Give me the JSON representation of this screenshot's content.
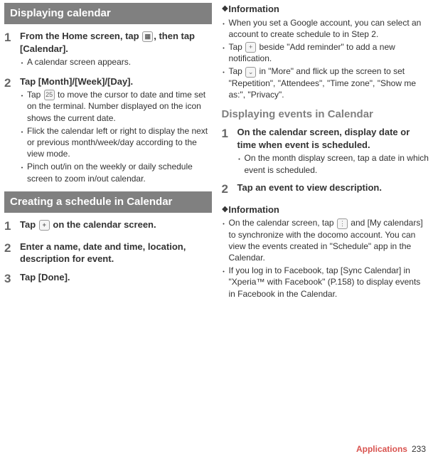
{
  "left": {
    "section1": {
      "title": "Displaying calendar",
      "steps": [
        {
          "num": "1",
          "title_a": "From the Home screen, tap ",
          "title_b": ", then tap [Calendar].",
          "icon": "grid-icon",
          "bullets": [
            "A calendar screen appears."
          ]
        },
        {
          "num": "2",
          "title": "Tap [Month]/[Week]/[Day].",
          "bullets_rich": [
            {
              "pre": "Tap ",
              "icon": "25",
              "post": " to move the cursor to date and time set on the terminal. Number displayed on the icon shows the current date."
            },
            {
              "text": "Flick the calendar left or right to display the next or previous month/week/day according to the view mode."
            },
            {
              "text": "Pinch out/in on the weekly or daily schedule screen to zoom in/out calendar."
            }
          ]
        }
      ]
    },
    "section2": {
      "title": "Creating a schedule in Calendar",
      "steps": [
        {
          "num": "1",
          "title_a": "Tap ",
          "icon": "+",
          "title_b": " on the calendar screen."
        },
        {
          "num": "2",
          "title": "Enter a name, date and time, location, description for event."
        },
        {
          "num": "3",
          "title": "Tap [Done]."
        }
      ]
    }
  },
  "right": {
    "info1": {
      "head": "Information",
      "bullets_rich": [
        {
          "text": "When you set a Google account, you can select an account to create schedule to in Step 2."
        },
        {
          "pre": "Tap ",
          "icon": "+",
          "post": " beside \"Add reminder\" to add a new notification."
        },
        {
          "pre": "Tap ",
          "icon": "⌄",
          "post": " in \"More\" and flick up the screen to set \"Repetition\", \"Attendees\", \"Time zone\", \"Show me as:\", \"Privacy\"."
        }
      ]
    },
    "subhead": "Displaying events in Calendar",
    "steps": [
      {
        "num": "1",
        "title": "On the calendar screen, display date or time when event is scheduled.",
        "bullets": [
          "On the month display screen, tap a date in which event is scheduled."
        ]
      },
      {
        "num": "2",
        "title": "Tap an event to view description."
      }
    ],
    "info2": {
      "head": "Information",
      "bullets_rich": [
        {
          "pre": "On the calendar screen, tap ",
          "icon": "⋮",
          "post": " and [My calendars] to synchronize with the docomo account. You can view the events created in \"Schedule\" app in the Calendar."
        },
        {
          "text": "If you log in to Facebook, tap [Sync Calendar] in \"Xperia™ with Facebook\" (P.158) to display events in Facebook in the Calendar."
        }
      ]
    }
  },
  "footer": {
    "label": "Applications",
    "page": "233"
  }
}
